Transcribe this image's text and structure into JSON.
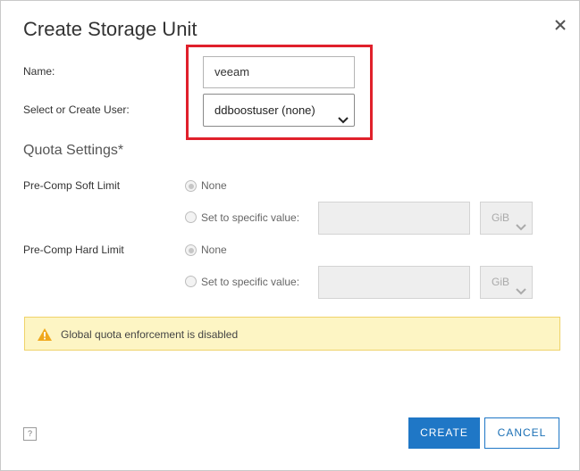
{
  "dialog": {
    "title": "Create Storage Unit",
    "close_icon": "close-icon"
  },
  "form": {
    "name_label": "Name:",
    "name_value": "veeam",
    "user_label": "Select or Create User:",
    "user_value": "ddboostuser (none)"
  },
  "quota": {
    "section_title": "Quota Settings*",
    "soft": {
      "label": "Pre-Comp Soft Limit",
      "none_label": "None",
      "specific_label": "Set to specific value:",
      "value": "",
      "unit": "GiB",
      "selected": "None"
    },
    "hard": {
      "label": "Pre-Comp Hard Limit",
      "none_label": "None",
      "specific_label": "Set to specific value:",
      "value": "",
      "unit": "GiB",
      "selected": "None"
    }
  },
  "warning": {
    "icon": "warning-icon",
    "text": "Global quota enforcement is disabled"
  },
  "footer": {
    "help_label": "?",
    "create_label": "CREATE",
    "cancel_label": "CANCEL"
  },
  "colors": {
    "highlight": "#e0202b",
    "primary": "#1f77c6",
    "warning_bg": "#fdf5c4",
    "warning_icon": "#f0a81c"
  }
}
